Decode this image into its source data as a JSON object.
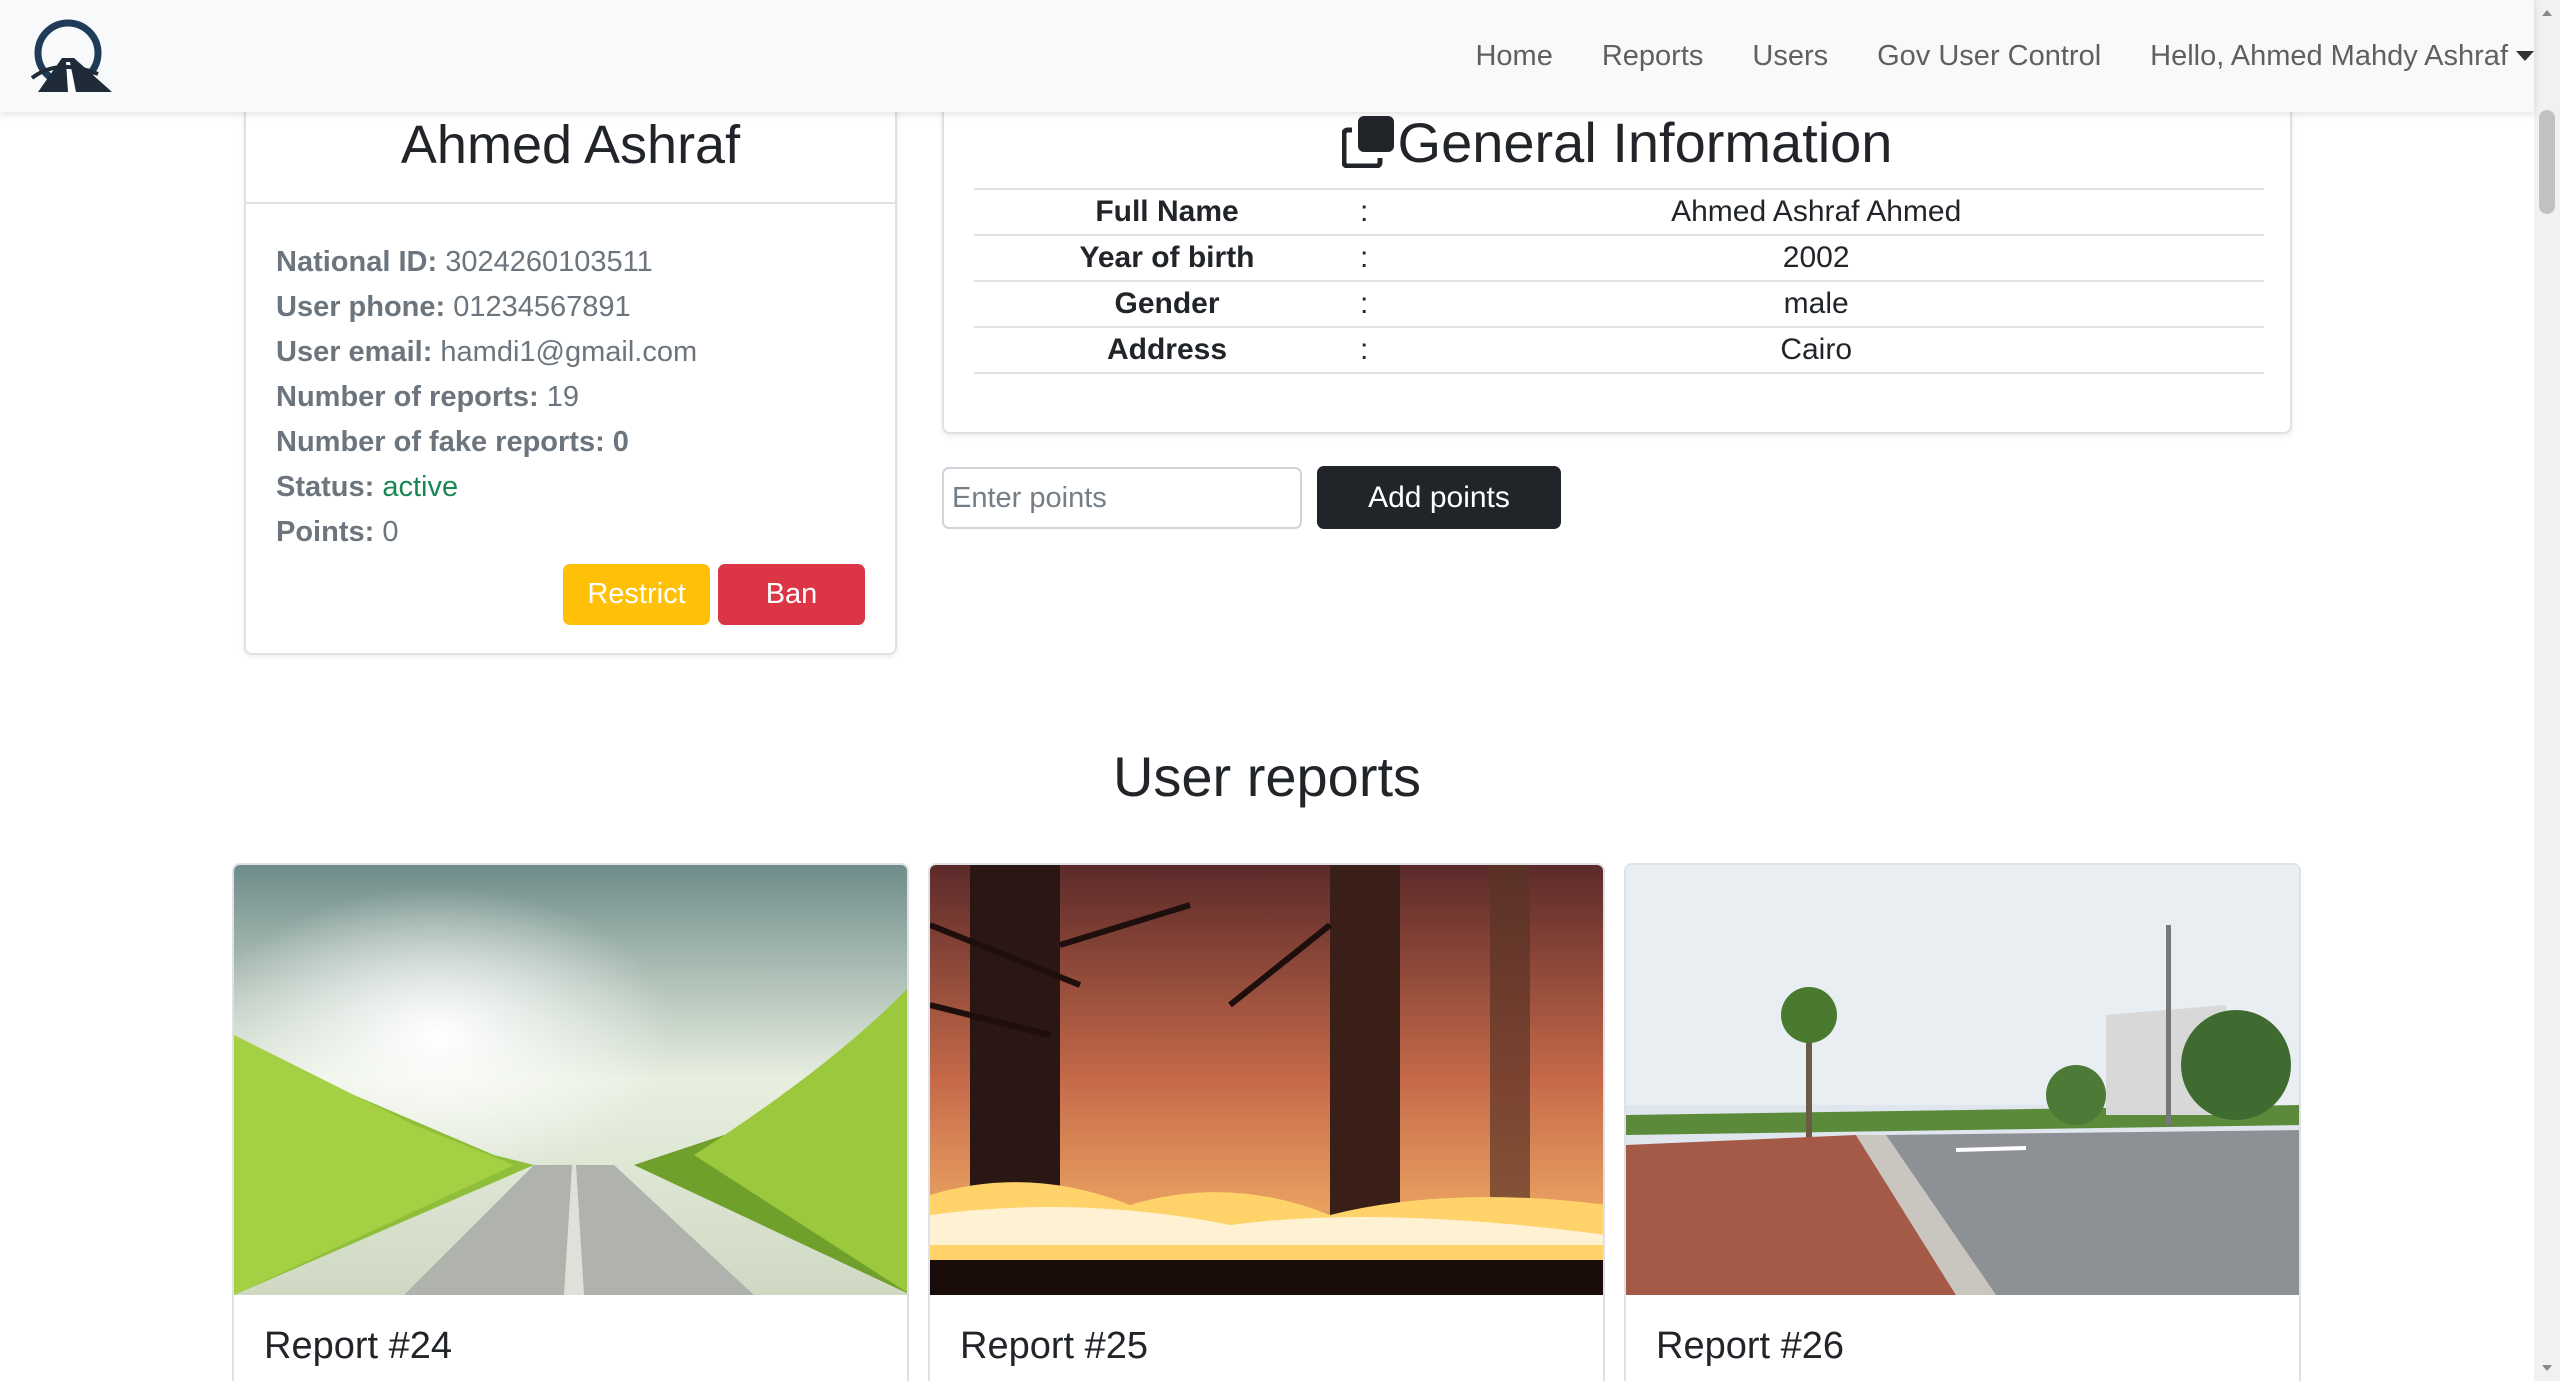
{
  "nav": {
    "links": [
      "Home",
      "Reports",
      "Users",
      "Gov User Control"
    ],
    "user_greeting": "Hello, Ahmed Mahdy Ashraf"
  },
  "profile": {
    "name": "Ahmed Ashraf",
    "national_id_label": "National ID:",
    "national_id": "3024260103511",
    "phone_label": "User phone:",
    "phone": "01234567891",
    "email_label": "User email:",
    "email": "hamdi1@gmail.com",
    "reports_label": "Number of reports:",
    "reports": "19",
    "fake_label": "Number of fake reports:",
    "fake": "0",
    "status_label": "Status:",
    "status": "active",
    "points_label": "Points:",
    "points": "0",
    "restrict_label": "Restrict",
    "ban_label": "Ban"
  },
  "general": {
    "title": "General Information",
    "rows": [
      {
        "key": "Full Name",
        "sep": ":",
        "value": "Ahmed Ashraf Ahmed"
      },
      {
        "key": "Year of birth",
        "sep": ":",
        "value": "2002"
      },
      {
        "key": "Gender",
        "sep": ":",
        "value": "male"
      },
      {
        "key": "Address",
        "sep": ":",
        "value": "Cairo"
      }
    ]
  },
  "points_form": {
    "placeholder": "Enter points",
    "button": "Add points"
  },
  "reports": {
    "title": "User reports",
    "items": [
      {
        "title": "Report #24"
      },
      {
        "title": "Report #25"
      },
      {
        "title": "Report #26"
      }
    ]
  },
  "colors": {
    "navbar_bg": "#f8f9fa",
    "restrict": "#ffc107",
    "ban": "#dc3545",
    "active": "#198754",
    "dark_button": "#212529"
  }
}
